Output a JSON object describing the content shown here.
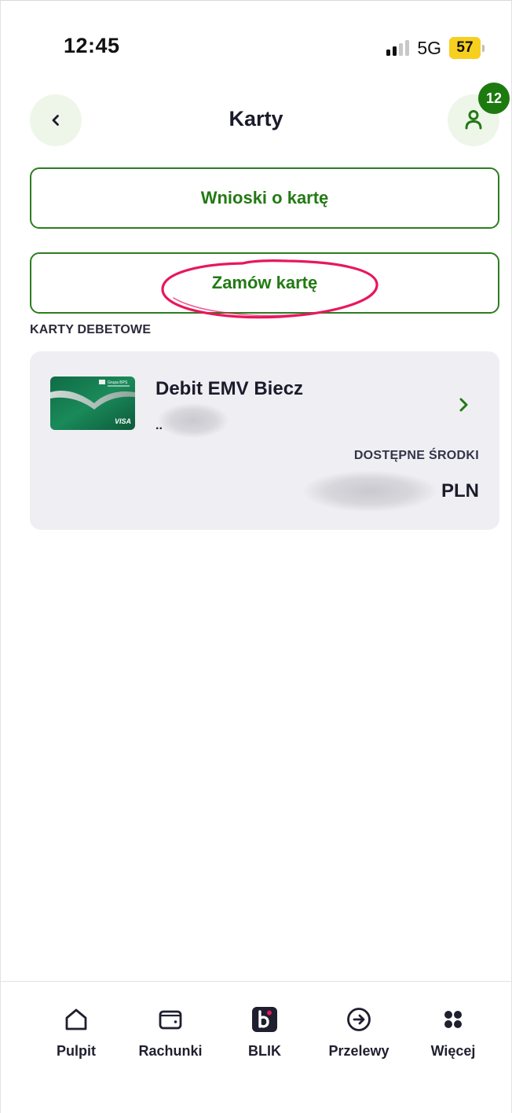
{
  "status_bar": {
    "time": "12:45",
    "network": "5G",
    "battery": "57"
  },
  "header": {
    "title": "Karty",
    "back_icon": "chevron-left-icon",
    "profile_icon": "user-icon",
    "notification_count": "12"
  },
  "actions": {
    "card_applications_label": "Wnioski o kartę",
    "order_card_label": "Zamów kartę"
  },
  "debit_cards": {
    "section_title": "KARTY DEBETOWE",
    "items": [
      {
        "name": "Debit EMV Biecz",
        "number_prefix": "..",
        "available_funds_label": "DOSTĘPNE ŚRODKI",
        "currency": "PLN",
        "card_issuer_text": "Grupa BPS",
        "card_network": "VISA"
      }
    ]
  },
  "bottom_nav": {
    "items": [
      {
        "label": "Pulpit",
        "icon": "home-icon"
      },
      {
        "label": "Rachunki",
        "icon": "wallet-icon"
      },
      {
        "label": "BLIK",
        "icon": "blik-icon"
      },
      {
        "label": "Przelewy",
        "icon": "arrow-right-circle-icon"
      },
      {
        "label": "Więcej",
        "icon": "grid-dots-icon"
      }
    ]
  },
  "colors": {
    "brand_green": "#237a14",
    "badge_green": "#1c7a0f",
    "circle_bg": "#eef6ea",
    "card_tile_bg": "#efeff3",
    "annotation_red": "#e8175d",
    "battery_yellow": "#f7cf1e"
  }
}
